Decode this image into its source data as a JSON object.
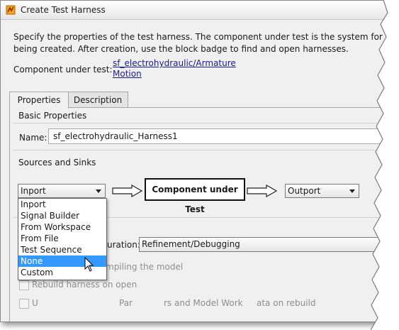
{
  "window": {
    "title": "Create Test Harness"
  },
  "description": {
    "line1": "Specify the properties of the test harness. The component under test is the system for w",
    "line2": "being created. After creation, use the block badge to find and open harnesses."
  },
  "component_under_test": {
    "label": "Component under test:",
    "link_line1": "sf_electrohydraulic/Armature",
    "link_line2": "Motion"
  },
  "tabs": [
    {
      "label": "Properties"
    },
    {
      "label": "Description"
    }
  ],
  "basic_properties": {
    "title": "Basic Properties",
    "name_label": "Name:",
    "name_value": "sf_electrohydraulic_Harness1"
  },
  "sources_sinks": {
    "title": "Sources and Sinks",
    "source_selected": "Inport",
    "cut_box": "Component under Test",
    "sink_selected": "Outport",
    "source_options": [
      "Inport",
      "Signal Builder",
      "From Workspace",
      "From File",
      "Test Sequence",
      "None",
      "Custom"
    ],
    "highlighted_option": "None"
  },
  "advanced": {
    "config_label": "uration:",
    "config_value": "Refinement/Debugging",
    "compile_text": "mpiling the model",
    "rebuild_text": "Rebuild harness on open",
    "update_text_a": "U",
    "update_text_b": "Par",
    "update_text_c": "rs and Model Work",
    "update_text_d": "ata on rebuild"
  }
}
